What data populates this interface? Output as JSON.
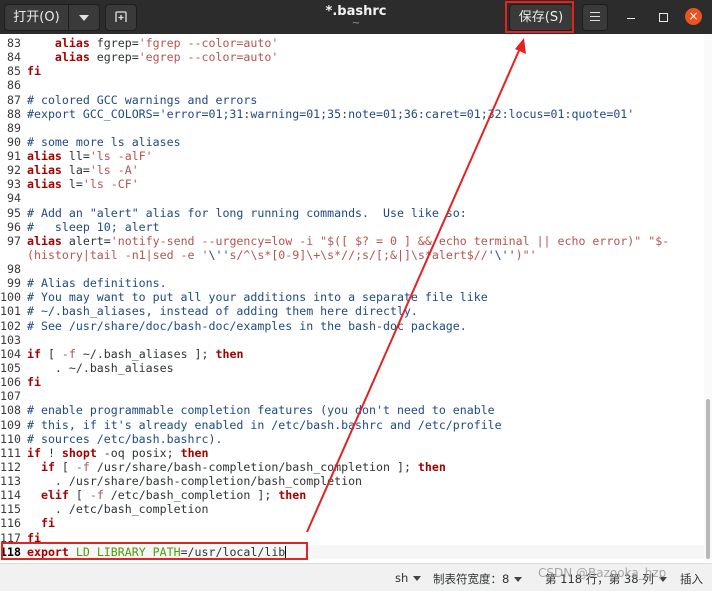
{
  "header": {
    "open_label": "打开(O)",
    "title": "*.bashrc",
    "subtitle": "~",
    "save_label": "保存(S)",
    "close_glyph": "×"
  },
  "editor": {
    "lines": [
      {
        "n": "83",
        "segs": [
          [
            "    ",
            ""
          ],
          [
            "alias",
            "kw"
          ],
          [
            " fgrep=",
            ""
          ],
          [
            "'fgrep --color=auto'",
            "str"
          ]
        ]
      },
      {
        "n": "84",
        "segs": [
          [
            "    ",
            ""
          ],
          [
            "alias",
            "kw"
          ],
          [
            " egrep=",
            ""
          ],
          [
            "'egrep --color=auto'",
            "str"
          ]
        ]
      },
      {
        "n": "85",
        "segs": [
          [
            "fi",
            "kw"
          ]
        ]
      },
      {
        "n": "86",
        "segs": []
      },
      {
        "n": "87",
        "segs": [
          [
            "# colored GCC warnings and errors",
            "com"
          ]
        ]
      },
      {
        "n": "88",
        "segs": [
          [
            "#export GCC_COLORS='error=01;31:warning=01;35:note=01;36:caret=01;32:locus=01:quote=01'",
            "com"
          ]
        ]
      },
      {
        "n": "89",
        "segs": []
      },
      {
        "n": "90",
        "segs": [
          [
            "# some more ls aliases",
            "com"
          ]
        ]
      },
      {
        "n": "91",
        "segs": [
          [
            "alias",
            "kw"
          ],
          [
            " ll=",
            ""
          ],
          [
            "'ls -alF'",
            "str"
          ]
        ]
      },
      {
        "n": "92",
        "segs": [
          [
            "alias",
            "kw"
          ],
          [
            " la=",
            ""
          ],
          [
            "'ls -A'",
            "str"
          ]
        ]
      },
      {
        "n": "93",
        "segs": [
          [
            "alias",
            "kw"
          ],
          [
            " l=",
            ""
          ],
          [
            "'ls -CF'",
            "str"
          ]
        ]
      },
      {
        "n": "94",
        "segs": []
      },
      {
        "n": "95",
        "segs": [
          [
            "# Add an \"alert\" alias for long running commands.  Use like so:",
            "com"
          ]
        ]
      },
      {
        "n": "96",
        "segs": [
          [
            "#   sleep 10; alert",
            "com"
          ]
        ]
      },
      {
        "n": "97",
        "segs": [
          [
            "alias",
            "kw"
          ],
          [
            " alert=",
            ""
          ],
          [
            "'notify-send --urgency=low -i \"$([ $? = 0 ] && echo terminal || echo error)\" \"$-",
            "str"
          ]
        ]
      },
      {
        "n": "",
        "segs": [
          [
            "(history|tail -n1|sed -e '",
            "str"
          ],
          [
            "\\''",
            "com"
          ],
          [
            "s/^\\s*[0-9]\\+\\s*//;s/[;&|]\\s*alert$//",
            "str"
          ],
          [
            "'\\''",
            "com"
          ],
          [
            ")\"'",
            "str"
          ]
        ]
      },
      {
        "n": "98",
        "segs": []
      },
      {
        "n": "99",
        "segs": [
          [
            "# Alias definitions.",
            "com"
          ]
        ]
      },
      {
        "n": "100",
        "segs": [
          [
            "# You may want to put all your additions into a separate file like",
            "com"
          ]
        ]
      },
      {
        "n": "101",
        "segs": [
          [
            "# ~/.bash_aliases, instead of adding them here directly.",
            "com"
          ]
        ]
      },
      {
        "n": "102",
        "segs": [
          [
            "# See /usr/share/doc/bash-doc/examples in the bash-doc package.",
            "com"
          ]
        ]
      },
      {
        "n": "103",
        "segs": []
      },
      {
        "n": "104",
        "segs": [
          [
            "if",
            "kw"
          ],
          [
            " [ ",
            ""
          ],
          [
            "-f",
            "str"
          ],
          [
            " ~/.bash_aliases ]; ",
            ""
          ],
          [
            "then",
            "kw"
          ]
        ]
      },
      {
        "n": "105",
        "segs": [
          [
            "    . ~/.bash_aliases",
            ""
          ]
        ]
      },
      {
        "n": "106",
        "segs": [
          [
            "fi",
            "kw"
          ]
        ]
      },
      {
        "n": "107",
        "segs": []
      },
      {
        "n": "108",
        "segs": [
          [
            "# enable programmable completion features (you don't need to enable",
            "com"
          ]
        ]
      },
      {
        "n": "109",
        "segs": [
          [
            "# this, if it's already enabled in /etc/bash.bashrc and /etc/profile",
            "com"
          ]
        ]
      },
      {
        "n": "110",
        "segs": [
          [
            "# sources /etc/bash.bashrc).",
            "com"
          ]
        ]
      },
      {
        "n": "111",
        "segs": [
          [
            "if",
            "kw"
          ],
          [
            " ! ",
            ""
          ],
          [
            "shopt",
            "kw"
          ],
          [
            " -oq posix; ",
            ""
          ],
          [
            "then",
            "kw"
          ]
        ]
      },
      {
        "n": "112",
        "segs": [
          [
            "  ",
            ""
          ],
          [
            "if",
            "kw"
          ],
          [
            " [ ",
            ""
          ],
          [
            "-f",
            "str"
          ],
          [
            " /usr/share/bash-completion/bash_completion ]; ",
            ""
          ],
          [
            "then",
            "kw"
          ]
        ]
      },
      {
        "n": "113",
        "segs": [
          [
            "    . /usr/share/bash-completion/bash_completion",
            ""
          ]
        ]
      },
      {
        "n": "114",
        "segs": [
          [
            "  ",
            ""
          ],
          [
            "elif",
            "kw"
          ],
          [
            " [ ",
            ""
          ],
          [
            "-f",
            "str"
          ],
          [
            " /etc/bash_completion ]; ",
            ""
          ],
          [
            "then",
            "kw"
          ]
        ]
      },
      {
        "n": "115",
        "segs": [
          [
            "    . /etc/bash_completion",
            ""
          ]
        ]
      },
      {
        "n": "116",
        "segs": [
          [
            "  ",
            ""
          ],
          [
            "fi",
            "kw"
          ]
        ]
      },
      {
        "n": "117",
        "segs": [
          [
            "fi",
            "kw"
          ]
        ]
      },
      {
        "n": "118",
        "segs": [
          [
            "export",
            "kw"
          ],
          [
            " ",
            ""
          ],
          [
            "LD_LIBRARY_PATH",
            "var"
          ],
          [
            "=/usr/local/lib",
            ""
          ]
        ],
        "current": true
      }
    ]
  },
  "status": {
    "language": "sh",
    "tab_width": "制表符宽度：8",
    "position": "第 118 行，第 38 列",
    "mode": "插入"
  },
  "watermark": "CSDN @Bazooka_hzp",
  "colors": {
    "annotation": "#e32222",
    "header_bg": "#2c2c2c",
    "close_bg": "#e95420"
  }
}
